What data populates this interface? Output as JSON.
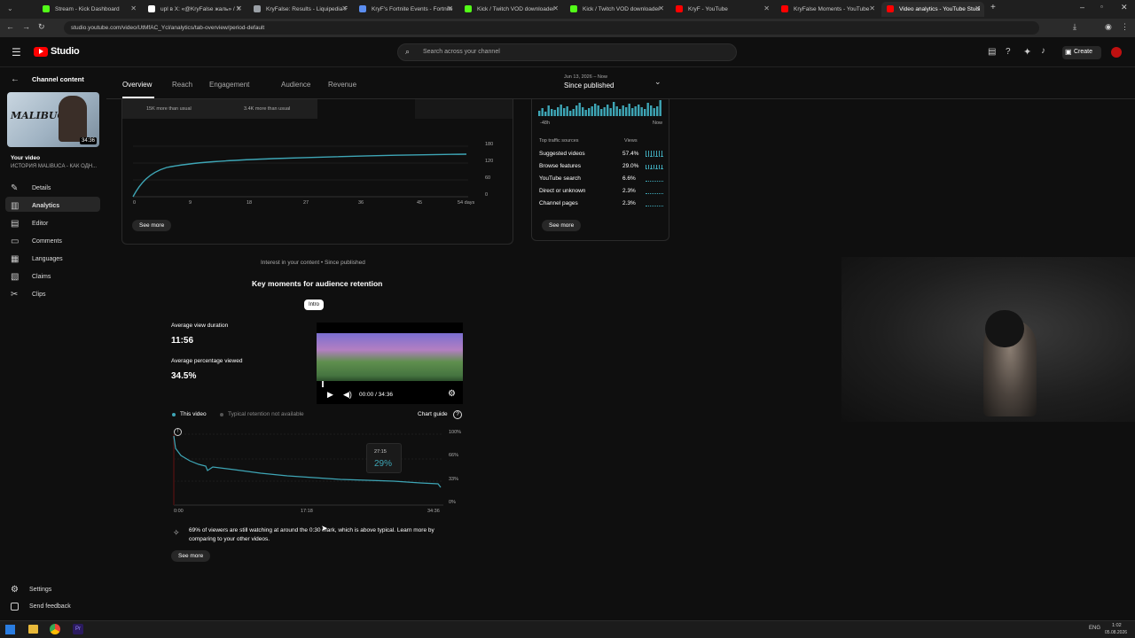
{
  "browser": {
    "tabs": [
      {
        "title": "Stream - Kick Dashboard",
        "color": "#53fc18"
      },
      {
        "title": "upl в X: «@KryFalse жаль» / X",
        "color": "#ffffff"
      },
      {
        "title": "KryFalse: Results - Liquipedia F",
        "color": "#9aa0a6"
      },
      {
        "title": "KryF's Fortnite Events - Fortnite",
        "color": "#5b8def"
      },
      {
        "title": "Kick / Twitch VOD downloader",
        "color": "#53fc18"
      },
      {
        "title": "Kick / Twitch VOD downloader",
        "color": "#53fc18"
      },
      {
        "title": "KryF - YouTube",
        "color": "#ff0000"
      },
      {
        "title": "KryFalse Moments - YouTube",
        "color": "#ff0000"
      },
      {
        "title": "Video analytics - YouTube Studi",
        "color": "#ff0000"
      }
    ],
    "url": "studio.youtube.com/video/UtMfAC_Ycl/analytics/tab-overview/period-default"
  },
  "header": {
    "logo": "Studio",
    "search_placeholder": "Search across your channel",
    "create_label": "Create"
  },
  "sidebar": {
    "back_label": "Channel content",
    "thumb_text": "MALIBUCA",
    "duration": "34:36",
    "your_video": "Your video",
    "video_title": "ИСТОРИЯ MALIBUCA - КАК ОДН...",
    "items": [
      {
        "label": "Details",
        "icon": "pencil-icon"
      },
      {
        "label": "Analytics",
        "icon": "analytics-icon"
      },
      {
        "label": "Editor",
        "icon": "editor-icon"
      },
      {
        "label": "Comments",
        "icon": "comments-icon"
      },
      {
        "label": "Languages",
        "icon": "languages-icon"
      },
      {
        "label": "Claims",
        "icon": "claims-icon"
      },
      {
        "label": "Clips",
        "icon": "clips-icon"
      }
    ],
    "settings": "Settings",
    "feedback": "Send feedback"
  },
  "tabs": [
    "Overview",
    "Reach",
    "Engagement",
    "Audience",
    "Revenue"
  ],
  "period": {
    "range": "Jun 13, 2026 – Now",
    "label": "Since published"
  },
  "metrics": {
    "sub1": "15K more than usual",
    "sub2": "3.4K more than usual"
  },
  "views_chart": {
    "y_ticks": [
      "180",
      "120",
      "60",
      "0"
    ],
    "x_ticks": [
      "0",
      "9",
      "18",
      "27",
      "36",
      "45",
      "54 days"
    ],
    "see_more": "See more"
  },
  "realtime": {
    "x_start": "-48h",
    "x_end": "Now",
    "sources_title": "Top traffic sources",
    "views_header": "Views",
    "sources": [
      {
        "name": "Suggested videos",
        "pct": "57.4%"
      },
      {
        "name": "Browse features",
        "pct": "29.0%"
      },
      {
        "name": "YouTube search",
        "pct": "6.6%"
      },
      {
        "name": "Direct or unknown",
        "pct": "2.3%"
      },
      {
        "name": "Channel pages",
        "pct": "2.3%"
      }
    ],
    "see_more": "See more"
  },
  "retention": {
    "interest": "Interest in your content • Since published",
    "title": "Key moments for audience retention",
    "chip": "Intro",
    "avd_label": "Average view duration",
    "avd_value": "11:56",
    "apv_label": "Average percentage viewed",
    "apv_value": "34.5%",
    "player_time": "00:00 / 34:36",
    "legend_this": "This video",
    "legend_typical": "Typical retention not available",
    "chart_guide": "Chart guide",
    "y_ticks": [
      "100%",
      "66%",
      "33%",
      "0%"
    ],
    "x_ticks": [
      "0:00",
      "17:18",
      "34:36"
    ],
    "tooltip_time": "27:15",
    "tooltip_value": "29%",
    "insight": "69% of viewers are still watching at around the 0:30 mark, which is above typical. Learn more by comparing to your other videos.",
    "see_more": "See more"
  },
  "taskbar": {
    "lang": "ENG",
    "time": "1:02",
    "date": "05.08.2026"
  }
}
